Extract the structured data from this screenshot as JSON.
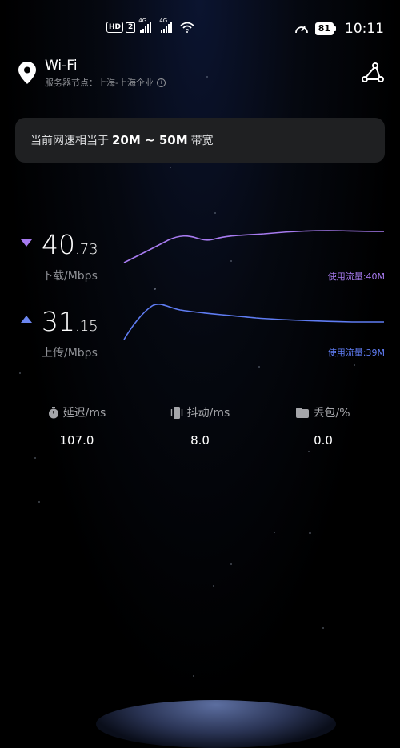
{
  "status_bar": {
    "hd_label": "HD",
    "sim_label": "2",
    "net1": "4G",
    "net2": "4G",
    "battery": "81",
    "time": "10:11"
  },
  "header": {
    "title": "Wi-Fi",
    "node_label": "服务器节点：上海-上海企业",
    "icons": {
      "location": "location-pin-icon",
      "share": "share-icon",
      "info": "info-icon"
    }
  },
  "banner": {
    "prefix": "当前网速相当于",
    "range": "20M ~ 50M",
    "suffix": "带宽"
  },
  "download": {
    "value_int": "40",
    "value_dec": ".73",
    "label": "下载/Mbps",
    "usage": "使用流量:40M",
    "color": "#a77bf0"
  },
  "upload": {
    "value_int": "31",
    "value_dec": ".15",
    "label": "上传/Mbps",
    "usage": "使用流量:39M",
    "color": "#5f7cf2"
  },
  "stats": [
    {
      "label": "延迟/ms",
      "value": "107.0",
      "icon": "stopwatch-icon"
    },
    {
      "label": "抖动/ms",
      "value": "8.0",
      "icon": "vibrate-icon"
    },
    {
      "label": "丢包/%",
      "value": "0.0",
      "icon": "folder-icon"
    }
  ]
}
